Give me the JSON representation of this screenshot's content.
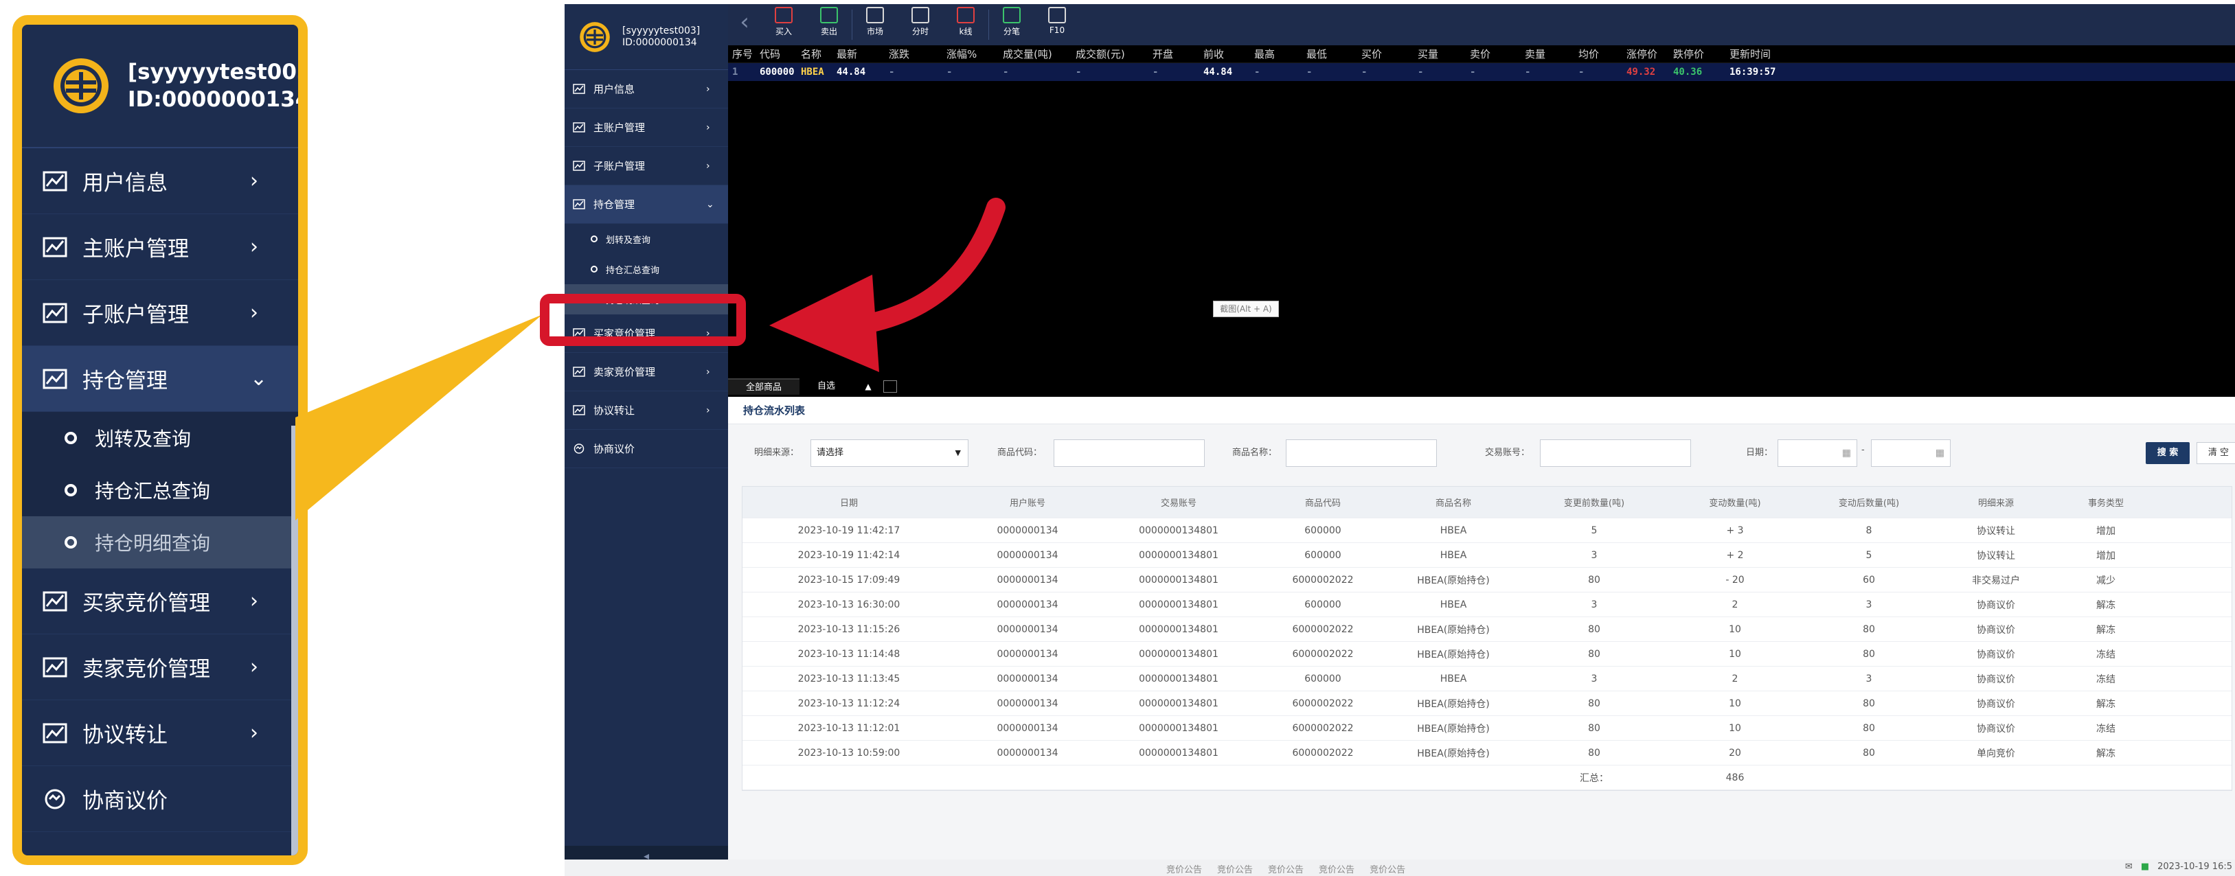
{
  "user": {
    "name": "[syyyyytest003]",
    "id": "ID:0000000134"
  },
  "nav": {
    "items": [
      {
        "label": "用户信息",
        "chevron": "›"
      },
      {
        "label": "主账户管理",
        "chevron": "›"
      },
      {
        "label": "子账户管理",
        "chevron": "›"
      },
      {
        "label": "持仓管理",
        "chevron": "⌄"
      }
    ],
    "sub_items": [
      "划转及查询",
      "持仓汇总查询",
      "持仓明细查询"
    ],
    "items_after": [
      {
        "label": "买家竞价管理",
        "chevron": "›"
      },
      {
        "label": "卖家竞价管理",
        "chevron": "›"
      },
      {
        "label": "协议转让",
        "chevron": "›"
      }
    ],
    "last_item": "协商议价",
    "collapse": "◂"
  },
  "toolbar": {
    "back": "‹",
    "buttons": [
      {
        "label": "买入",
        "icon": "buy-icon"
      },
      {
        "label": "卖出",
        "icon": "sell-icon"
      },
      {
        "label": "市场",
        "icon": "market-icon"
      },
      {
        "label": "分时",
        "icon": "time-share-icon"
      },
      {
        "label": "k线",
        "icon": "kline-icon"
      },
      {
        "label": "分笔",
        "icon": "tick-icon"
      },
      {
        "label": "F10",
        "icon": "f10-icon"
      }
    ]
  },
  "quote": {
    "headers": [
      "序号",
      "代码",
      "名称",
      "最新",
      "涨跌",
      "涨幅%",
      "成交量(吨)",
      "成交额(元)",
      "开盘",
      "前收",
      "最高",
      "最低",
      "买价",
      "买量",
      "卖价",
      "卖量",
      "均价",
      "涨停价",
      "跌停价",
      "更新时间"
    ],
    "row": [
      "1",
      "600000",
      "HBEA",
      "44.84",
      "-",
      "-",
      "-",
      "-",
      "-",
      "44.84",
      "-",
      "-",
      "-",
      "-",
      "-",
      "-",
      "-",
      "49.32",
      "40.36",
      "16:39:57"
    ]
  },
  "market_tabs": {
    "all": "全部商品",
    "custom": "自选",
    "arrow": "▲"
  },
  "panel": {
    "title": "持仓流水列表",
    "filters": {
      "source_label": "明细来源：",
      "source_value": "请选择",
      "code_label": "商品代码：",
      "name_label": "商品名称：",
      "account_label": "交易账号：",
      "date_label": "日期：",
      "date_sep": "-",
      "search": "搜 索",
      "clear": "清 空"
    },
    "columns": [
      "日期",
      "用户账号",
      "交易账号",
      "商品代码",
      "商品名称",
      "变更前数量(吨)",
      "变动数量(吨)",
      "变动后数量(吨)",
      "明细来源",
      "事务类型"
    ],
    "rows": [
      [
        "2023-10-19 11:42:17",
        "0000000134",
        "0000000134801",
        "600000",
        "HBEA",
        "5",
        "+ 3",
        "8",
        "协议转让",
        "增加"
      ],
      [
        "2023-10-19 11:42:14",
        "0000000134",
        "0000000134801",
        "600000",
        "HBEA",
        "3",
        "+ 2",
        "5",
        "协议转让",
        "增加"
      ],
      [
        "2023-10-15 17:09:49",
        "0000000134",
        "0000000134801",
        "6000002022",
        "HBEA(原始持仓)",
        "80",
        "- 20",
        "60",
        "非交易过户",
        "减少"
      ],
      [
        "2023-10-13 16:30:00",
        "0000000134",
        "0000000134801",
        "600000",
        "HBEA",
        "3",
        "2",
        "3",
        "协商议价",
        "解冻"
      ],
      [
        "2023-10-13 11:15:26",
        "0000000134",
        "0000000134801",
        "6000002022",
        "HBEA(原始持仓)",
        "80",
        "10",
        "80",
        "协商议价",
        "解冻"
      ],
      [
        "2023-10-13 11:14:48",
        "0000000134",
        "0000000134801",
        "6000002022",
        "HBEA(原始持仓)",
        "80",
        "10",
        "80",
        "协商议价",
        "冻结"
      ],
      [
        "2023-10-13 11:13:45",
        "0000000134",
        "0000000134801",
        "600000",
        "HBEA",
        "3",
        "2",
        "3",
        "协商议价",
        "冻结"
      ],
      [
        "2023-10-13 11:12:24",
        "0000000134",
        "0000000134801",
        "6000002022",
        "HBEA(原始持仓)",
        "80",
        "10",
        "80",
        "协商议价",
        "解冻"
      ],
      [
        "2023-10-13 11:12:01",
        "0000000134",
        "0000000134801",
        "6000002022",
        "HBEA(原始持仓)",
        "80",
        "10",
        "80",
        "协商议价",
        "冻结"
      ],
      [
        "2023-10-13 10:59:00",
        "0000000134",
        "0000000134801",
        "6000002022",
        "HBEA(原始持仓)",
        "80",
        "20",
        "80",
        "单向竞价",
        "解冻"
      ]
    ],
    "summary_label": "汇总：",
    "summary_value": "486"
  },
  "tooltip": "截图(Alt + A)",
  "status": {
    "notices": [
      "竞价公告",
      "竞价公告",
      "竞价公告",
      "竞价公告",
      "竞价公告"
    ],
    "datetime": "2023-10-19 16:5"
  },
  "colors": {
    "nav_bg": "#1d2d4f",
    "callout_border": "#f6b81d",
    "highlight": "#d6162a",
    "up": "#e04040",
    "down": "#3bc46b"
  }
}
